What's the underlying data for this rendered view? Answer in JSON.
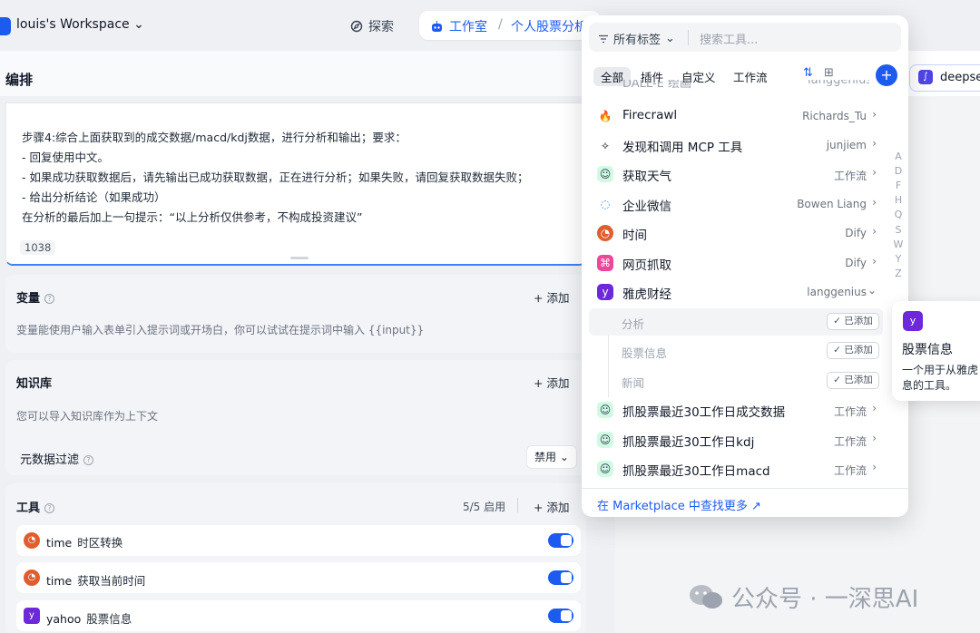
{
  "topbar": {
    "workspace": "louis's Workspace",
    "explore": "探索",
    "studio": "工作室",
    "separator": "/",
    "app_name": "个人股票分析"
  },
  "left": {
    "title": "编排",
    "prompt_lines": [
      "步骤4:综合上面获取到的成交数据/macd/kdj数据，进行分析和输出；要求：",
      "- 回复使用中文。",
      "- 如果成功获取数据后，请先输出已成功获取数据，正在进行分析；如果失败，请回复获取数据失败；",
      "- 给出分析结论（如果成功）",
      "在分析的最后加上一句提示：“以上分析仅供参考，不构成投资建议”"
    ],
    "char_count": "1038",
    "variables": {
      "title": "变量",
      "add": "+ 添加",
      "desc": "变量能使用户输入表单引入提示词或开场白，你可以试试在提示词中输入 {{input}}"
    },
    "knowledge": {
      "title": "知识库",
      "add": "+ 添加",
      "desc": "您可以导入知识库作为上下文",
      "metadata_filter": "元数据过滤",
      "filter_value": "禁用"
    },
    "tools": {
      "title": "工具",
      "count": "5/5 启用",
      "add": "+ 添加",
      "items": [
        {
          "name": "time",
          "desc": "时区转换"
        },
        {
          "name": "time",
          "desc": "获取当前时间"
        },
        {
          "name": "yahoo",
          "desc": "股票信息"
        }
      ]
    }
  },
  "right": {
    "model": "deepse"
  },
  "dropdown": {
    "tag_filter": "所有标签",
    "search_placeholder": "搜索工具...",
    "tabs": [
      "全部",
      "插件",
      "自定义",
      "工作流"
    ],
    "clipped_item": {
      "name": "DALL-E 绘画",
      "author": "langgenius"
    },
    "items": [
      {
        "name": "Firecrawl",
        "author": "Richards_Tu",
        "icon": "firecrawl"
      },
      {
        "name": "发现和调用 MCP 工具",
        "author": "junjiem",
        "icon": "mcp"
      },
      {
        "name": "获取天气",
        "author": "工作流",
        "icon": "robot"
      },
      {
        "name": "企业微信",
        "author": "Bowen Liang",
        "icon": "wecom"
      },
      {
        "name": "时间",
        "author": "Dify",
        "icon": "clock"
      },
      {
        "name": "网页抓取",
        "author": "Dify",
        "icon": "scrape"
      },
      {
        "name": "雅虎财经",
        "author": "langgenius",
        "icon": "yahoo"
      }
    ],
    "sub_items": [
      {
        "name": "分析",
        "badge": "✓ 已添加"
      },
      {
        "name": "股票信息",
        "badge": "✓ 已添加"
      },
      {
        "name": "新闻",
        "badge": "✓ 已添加"
      }
    ],
    "workflow_items": [
      {
        "name": "抓股票最近30工作日成交数据",
        "author": "工作流"
      },
      {
        "name": "抓股票最近30工作日kdj",
        "author": "工作流"
      },
      {
        "name": "抓股票最近30工作日macd",
        "author": "工作流"
      }
    ],
    "marketplace": "在 Marketplace 中查找更多 ↗",
    "alphabet": [
      "A",
      "D",
      "F",
      "H",
      "Q",
      "S",
      "W",
      "Y",
      "Z"
    ]
  },
  "tooltip": {
    "title": "股票信息",
    "desc_lines": [
      "一个用于从雅虎",
      "息的工具。"
    ]
  },
  "watermark": "公众号 · 一深思AI"
}
